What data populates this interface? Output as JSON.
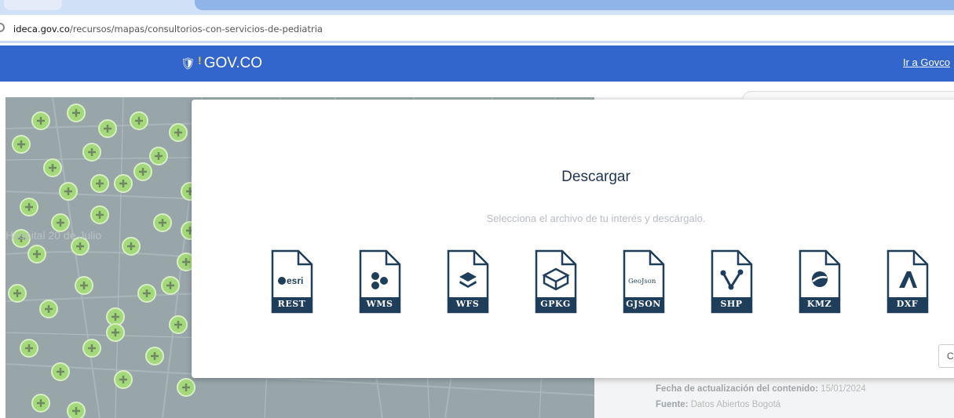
{
  "browser": {
    "url_domain": "ideca.gov.co",
    "url_path": "/recursos/mapas/consultorios-con-servicios-de-pediatria"
  },
  "govbar": {
    "logo_text": "GOV.CO",
    "link_text": "Ir a Govco",
    "color": "#3366cc"
  },
  "map": {
    "label": "Hospital 20 de Julio"
  },
  "side_panel": {
    "updated_label": "Fecha de actualización del contenido:",
    "updated_value": "15/01/2024",
    "source_label": "Fuente:",
    "source_value": "Datos Abiertos Bogotá"
  },
  "modal": {
    "title": "Descargar",
    "subtitle": "Selecciona el archivo de tu interés y descárgalo.",
    "close_label": "C",
    "files": [
      {
        "label": "REST",
        "icon": "esri-icon",
        "icon_text": "esri"
      },
      {
        "label": "WMS",
        "icon": "wms-hexagons-icon"
      },
      {
        "label": "WFS",
        "icon": "wfs-layers-icon"
      },
      {
        "label": "GPKG",
        "icon": "geopackage-box-icon"
      },
      {
        "label": "GJSON",
        "icon": "geojson-icon",
        "icon_text": "GeoJson"
      },
      {
        "label": "SHP",
        "icon": "shapefile-vector-icon"
      },
      {
        "label": "KMZ",
        "icon": "google-earth-icon"
      },
      {
        "label": "DXF",
        "icon": "autocad-icon"
      }
    ],
    "file_color": "#1e3e5c"
  }
}
